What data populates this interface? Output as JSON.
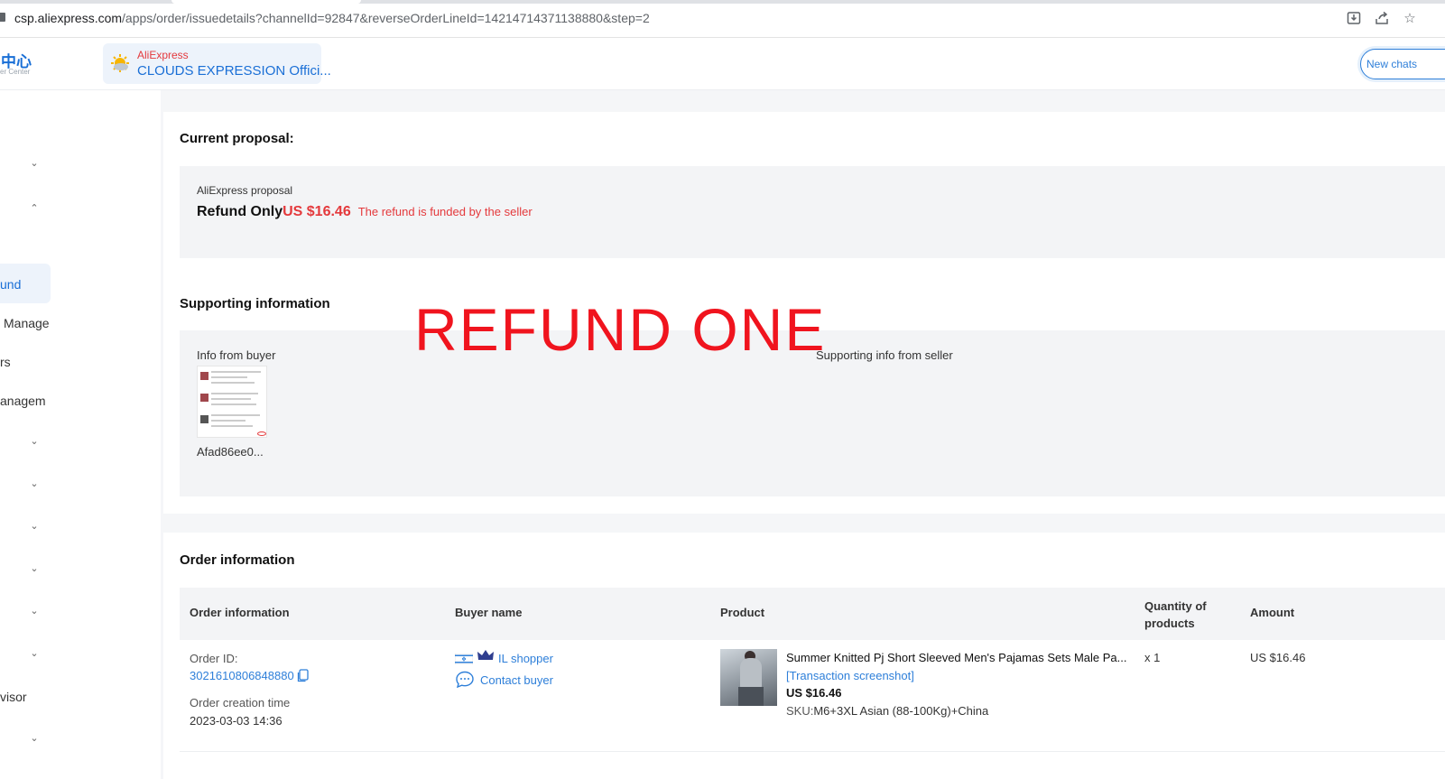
{
  "browser": {
    "url_host": "csp.aliexpress.com",
    "url_path": "/apps/order/issuedetails?channelId=92847&reverseOrderLineId=14214714371138880&step=2"
  },
  "header": {
    "logo_zh": "中心",
    "logo_en": "er Center",
    "store_brand": "AliExpress",
    "store_name": "CLOUDS EXPRESSION Offici...",
    "new_chats": "New chats"
  },
  "sidebar": {
    "items": [
      "und",
      "Manage",
      "rs",
      "anagem",
      "visor"
    ]
  },
  "proposal": {
    "title": "Current proposal:",
    "label": "AliExpress proposal",
    "type": "Refund Only",
    "amount": "US $16.46",
    "note": "The refund is funded by the seller"
  },
  "supporting": {
    "title": "Supporting information",
    "buyer_label": "Info from buyer",
    "seller_label": "Supporting info from seller",
    "file_name": "Afad86ee0..."
  },
  "overlay": "REFUND ONE",
  "order": {
    "title": "Order information",
    "columns": [
      "Order information",
      "Buyer name",
      "Product",
      "Quantity of products",
      "Amount"
    ],
    "order_id_label": "Order ID:",
    "order_id": "3021610806848880",
    "created_label": "Order creation time",
    "created": "2023-03-03 14:36",
    "buyer": "IL shopper",
    "contact": "Contact buyer",
    "product_name": "Summer Knitted Pj Short Sleeved Men's Pajamas Sets Male Pa...",
    "transaction_link": "[Transaction screenshot]",
    "product_price": "US $16.46",
    "sku_label": "SKU:",
    "sku": "M6+3XL Asian (88-100Kg)+China",
    "quantity": "x 1",
    "amount": "US $16.46"
  },
  "colors": {
    "accent": "#2e7fd9",
    "refund_red": "#e4393c",
    "overlay_red": "#f0141e"
  }
}
